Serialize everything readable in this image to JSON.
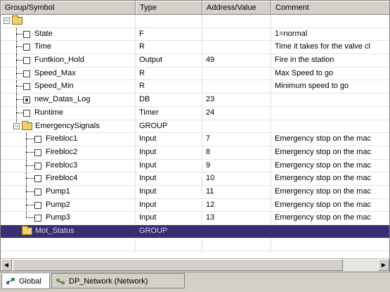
{
  "columns": {
    "c1": "Group/Symbol",
    "c2": "Type",
    "c3": "Address/Value",
    "c4": "Comment"
  },
  "rows": [
    {
      "name": "",
      "type": "",
      "value": "",
      "comment": ""
    },
    {
      "name": "State",
      "type": "F",
      "value": "",
      "comment": "1=normal"
    },
    {
      "name": "Time",
      "type": "R",
      "value": "",
      "comment": "Time it takes for the valve cl"
    },
    {
      "name": "Funtkion_Hold",
      "type": "Output",
      "value": "49",
      "comment": " Fire in the station"
    },
    {
      "name": "Speed_Max",
      "type": "R",
      "value": "",
      "comment": "Max Speed to go"
    },
    {
      "name": "Speed_Min",
      "type": "R",
      "value": "",
      "comment": "Minimum speed to go"
    },
    {
      "name": "new_Datas_Log",
      "type": "DB",
      "value": "23",
      "comment": ""
    },
    {
      "name": "Runtime",
      "type": "Timer",
      "value": "24",
      "comment": ""
    },
    {
      "name": "EmergencySignals",
      "type": "GROUP",
      "value": "",
      "comment": ""
    },
    {
      "name": "Firebloc1",
      "type": "Input",
      "value": "7",
      "comment": "  Emergency stop on the mac"
    },
    {
      "name": "Firebloc2",
      "type": "Input",
      "value": "8",
      "comment": "  Emergency stop on the mac"
    },
    {
      "name": "Firebloc3",
      "type": "Input",
      "value": "9",
      "comment": "  Emergency stop on the mac"
    },
    {
      "name": "Firebloc4",
      "type": "Input",
      "value": "10",
      "comment": "  Emergency stop on the mac"
    },
    {
      "name": "Pump1",
      "type": "Input",
      "value": "11",
      "comment": "  Emergency stop on the mac"
    },
    {
      "name": "Pump2",
      "type": "Input",
      "value": "12",
      "comment": "  Emergency stop on the mac"
    },
    {
      "name": "Pump3",
      "type": "Input",
      "value": "13",
      "comment": "  Emergency stop on the mac"
    },
    {
      "name": "Mot_Status",
      "type": "GROUP",
      "value": "",
      "comment": ""
    }
  ],
  "tabs": {
    "global": "Global",
    "network": "DP_Network (Network)"
  }
}
